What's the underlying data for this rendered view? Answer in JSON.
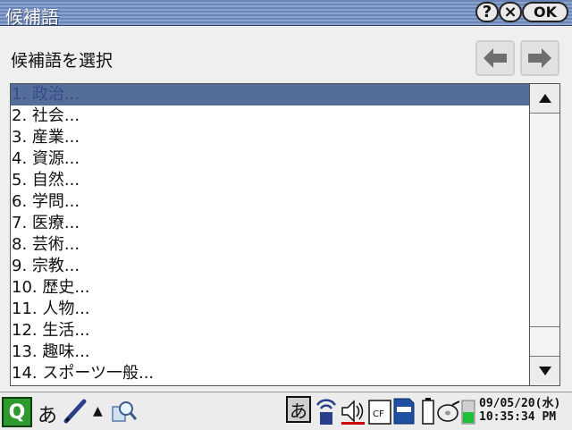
{
  "window": {
    "title": "候補語",
    "buttons": {
      "help": "?",
      "close": "×",
      "ok": "OK"
    }
  },
  "prompt": "候補語を選択",
  "candidates": [
    "1. 政治...",
    "2. 社会...",
    "3. 産業...",
    "4. 資源...",
    "5. 自然...",
    "6. 学問...",
    "7. 医療...",
    "8. 芸術...",
    "9. 宗教...",
    "10. 歴史...",
    "11. 人物...",
    "12. 生活...",
    "13. 趣味...",
    "14. スポーツ一般..."
  ],
  "selected_index": 0,
  "taskbar": {
    "ime_mode": "あ",
    "ime_box": "あ",
    "date": "09/05/20(水)",
    "time": "10:35:34 PM",
    "icons": [
      "q-menu-icon",
      "pen-icon",
      "zoom-icon",
      "input-mode-icon",
      "wireless-icon",
      "speaker-icon",
      "cf-card-icon",
      "sd-card-icon",
      "battery-icon",
      "disc-icon"
    ]
  },
  "colors": {
    "selection": "#536e99",
    "titlebar": "#7a94c2"
  }
}
